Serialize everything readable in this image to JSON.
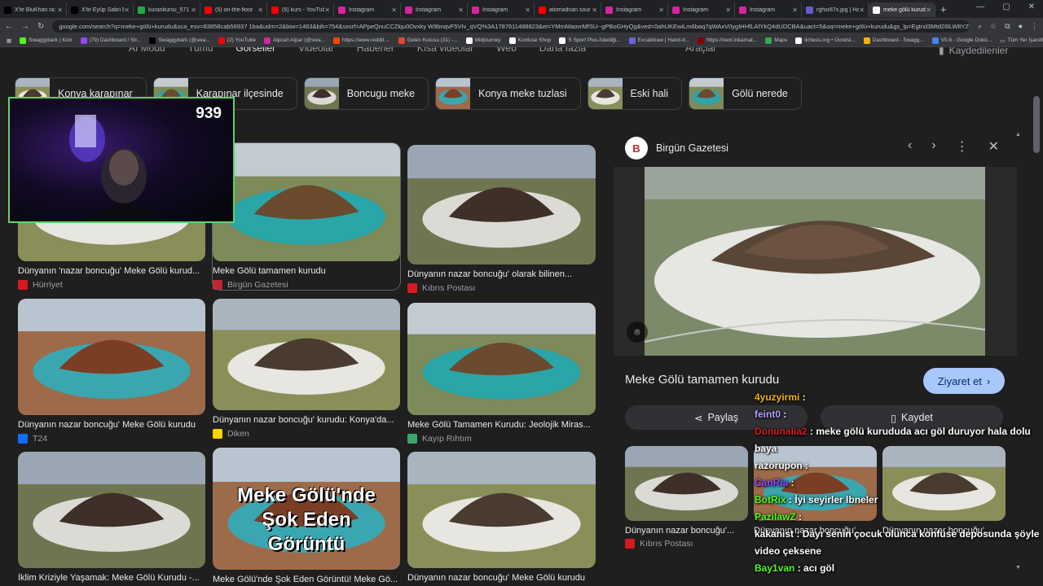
{
  "browser": {
    "tabs": [
      {
        "label": "X'te BluKhan ra:",
        "color": "#000000"
      },
      {
        "label": "X'te Eyüp Sabri E",
        "color": "#000000"
      },
      {
        "label": "kurankursu_571 S",
        "color": "#1faa4b"
      },
      {
        "label": "(5) on-the-floor",
        "color": "#ff0000"
      },
      {
        "label": "(5) kurs - YouTub",
        "color": "#ff0000"
      },
      {
        "label": "Instagram",
        "color": "#d6249f"
      },
      {
        "label": "Instagram",
        "color": "#d6249f"
      },
      {
        "label": "Instagram",
        "color": "#d6249f"
      },
      {
        "label": "atomadnan sour",
        "color": "#ff0000"
      },
      {
        "label": "Instagram",
        "color": "#d6249f"
      },
      {
        "label": "Instagram",
        "color": "#d6249f"
      },
      {
        "label": "Instagram",
        "color": "#d6249f"
      },
      {
        "label": "rghsr87x.jpg | Ha",
        "color": "#6a5acd"
      },
      {
        "label": "meke gölü kurud",
        "color": "#ffffff"
      }
    ],
    "new_tab": "+",
    "url": "google.com/search?q=meke+gölü+kurudu&sca_esv=83858cab56937 1ba&udm=2&biw=1463&bih=754&sxsrf=APpeQnuCCZkju0Ovxky W9bnqvF5VIv_qVQ%3A1787611488823&ei=YMmMaovrMfSU--gPBoGHyQg&ved=0ahUKEwiLm6baq7qWAxV0ygIHHfLAfYkQ4dUDCBA&uact=5&oq=meke+gölü+kurudu&gs_lp=Egtnd3Mtd26lLWltYZyISbW...",
    "bookmarks": [
      {
        "label": "Swaggybark | Kick",
        "color": "#53fc18"
      },
      {
        "label": "(79) Dashboard / Str...",
        "color": "#9146ff"
      },
      {
        "label": "Swaggybark (@swa...",
        "color": "#000000"
      },
      {
        "label": "(2) YouTube",
        "color": "#ff0000"
      },
      {
        "label": "Alpcan Alpar (@swa...",
        "color": "#d6249f"
      },
      {
        "label": "https://www.reddit....",
        "color": "#ff4500"
      },
      {
        "label": "Gelen Kutusu (31) -...",
        "color": "#ea4335"
      },
      {
        "label": "Midjourney",
        "color": "#ffffff"
      },
      {
        "label": "Konfuse Shop",
        "color": "#ffffff"
      },
      {
        "label": "S Sport Plus-İstediği...",
        "color": "#ffffff"
      },
      {
        "label": "Excalidraw | Hand-d...",
        "color": "#6965db"
      },
      {
        "label": "https://next.inkarnat...",
        "color": "#8b0000"
      },
      {
        "label": "Maps",
        "color": "#34a853"
      },
      {
        "label": "lichess.org • Ücretsi...",
        "color": "#ffffff"
      },
      {
        "label": "Dashboard - Swagg...",
        "color": "#f4b400"
      },
      {
        "label": "V0.8 - Google Dokü...",
        "color": "#4285f4"
      }
    ],
    "bookmarks_right": "Tüm Yer İşaretleri"
  },
  "search": {
    "nav_tabs": [
      "AI Modu",
      "Tümü",
      "Görseller",
      "Videolar",
      "Haberler",
      "Kısa videolar",
      "Web",
      "Daha fazla",
      "Araçlar"
    ],
    "saved_label": "Kaydedilenler",
    "chips": [
      "Konya karapınar",
      "Karapınar ilçesinde",
      "Boncugu meke",
      "Konya meke tuzlasi",
      "Eski hali",
      "Gölü nerede"
    ]
  },
  "results": [
    {
      "title": "Dünyanın 'nazar boncuğu' Meke Gölü kurud...",
      "source": "Hürriyet",
      "src_color": "#d71920"
    },
    {
      "title": "Meke Gölü tamamen kurudu",
      "source": "Birgün Gazetesi",
      "src_color": "#c1272d"
    },
    {
      "title": "Dünyanın nazar boncuğu' olarak bilinen...",
      "source": "Kıbrıs Postası",
      "src_color": "#d71920"
    },
    {
      "title": "Dünyanın nazar boncuğu' Meke Gölü kurudu",
      "source": "T24",
      "src_color": "#0d6efd"
    },
    {
      "title": "Dünyanın nazar boncuğu' kurudu: Konya'da...",
      "source": "Diken",
      "src_color": "#ffd200"
    },
    {
      "title": "Meke Gölü Tamamen Kurudu: Jeolojik Miras...",
      "source": "Kayıp Rıhtım",
      "src_color": "#3aa66b"
    },
    {
      "title": "İklim Kriziyle Yaşamak: Meke Gölü Kurudu -...",
      "source": "",
      "src_color": "#888888"
    },
    {
      "title": "Meke Gölü'nde Şok Eden Görüntü! Meke Gö...",
      "source": "",
      "src_color": "#888888",
      "overlay": "Meke Gölü'nde Şok Eden Görüntü"
    },
    {
      "title": "Dünyanın nazar boncuğu' Meke Gölü kurudu",
      "source": "",
      "src_color": "#888888"
    }
  ],
  "webcam": {
    "counter": "939"
  },
  "panel": {
    "source": "Birgün Gazetesi",
    "logo": "B",
    "title": "Meke Gölü tamamen kurudu",
    "visit_label": "Ziyaret et",
    "share_label": "Paylaş",
    "save_label": "Kaydet",
    "related": [
      {
        "title": "Dünyanın nazar boncuğu'...",
        "source": "Kıbrıs Postası"
      },
      {
        "title": "Dünyanın nazar boncuğu'...",
        "source": ""
      },
      {
        "title": "Dünyanın nazar boncuğu'...",
        "source": ""
      }
    ]
  },
  "chat": [
    {
      "user": "4yuzyirmi",
      "user_color": "#f4b400",
      "message": ""
    },
    {
      "user": "feint0",
      "user_color": "#b0a4ff",
      "message": ""
    },
    {
      "user": "Donunalia2",
      "user_color": "#d7191f",
      "message": "meke gölü kurududa acı göl duruyor hala dolu baya"
    },
    {
      "user": "razorupon",
      "user_color": "#ffffff",
      "message": ""
    },
    {
      "user": "CanRia",
      "user_color": "#9146ff",
      "message": ""
    },
    {
      "user": "BotRix",
      "user_color": "#53fc18",
      "message": "İyi seyirler lbneler"
    },
    {
      "user": "PazilawZ",
      "user_color": "#53fc18",
      "message": ""
    },
    {
      "user": "kakanist",
      "user_color": "#ffffff",
      "message": "Dayı senin çocuk olunca konfüse deposunda şöyle video çeksene"
    },
    {
      "user": "Bay1van",
      "user_color": "#53fc18",
      "message": "acı göl"
    }
  ]
}
